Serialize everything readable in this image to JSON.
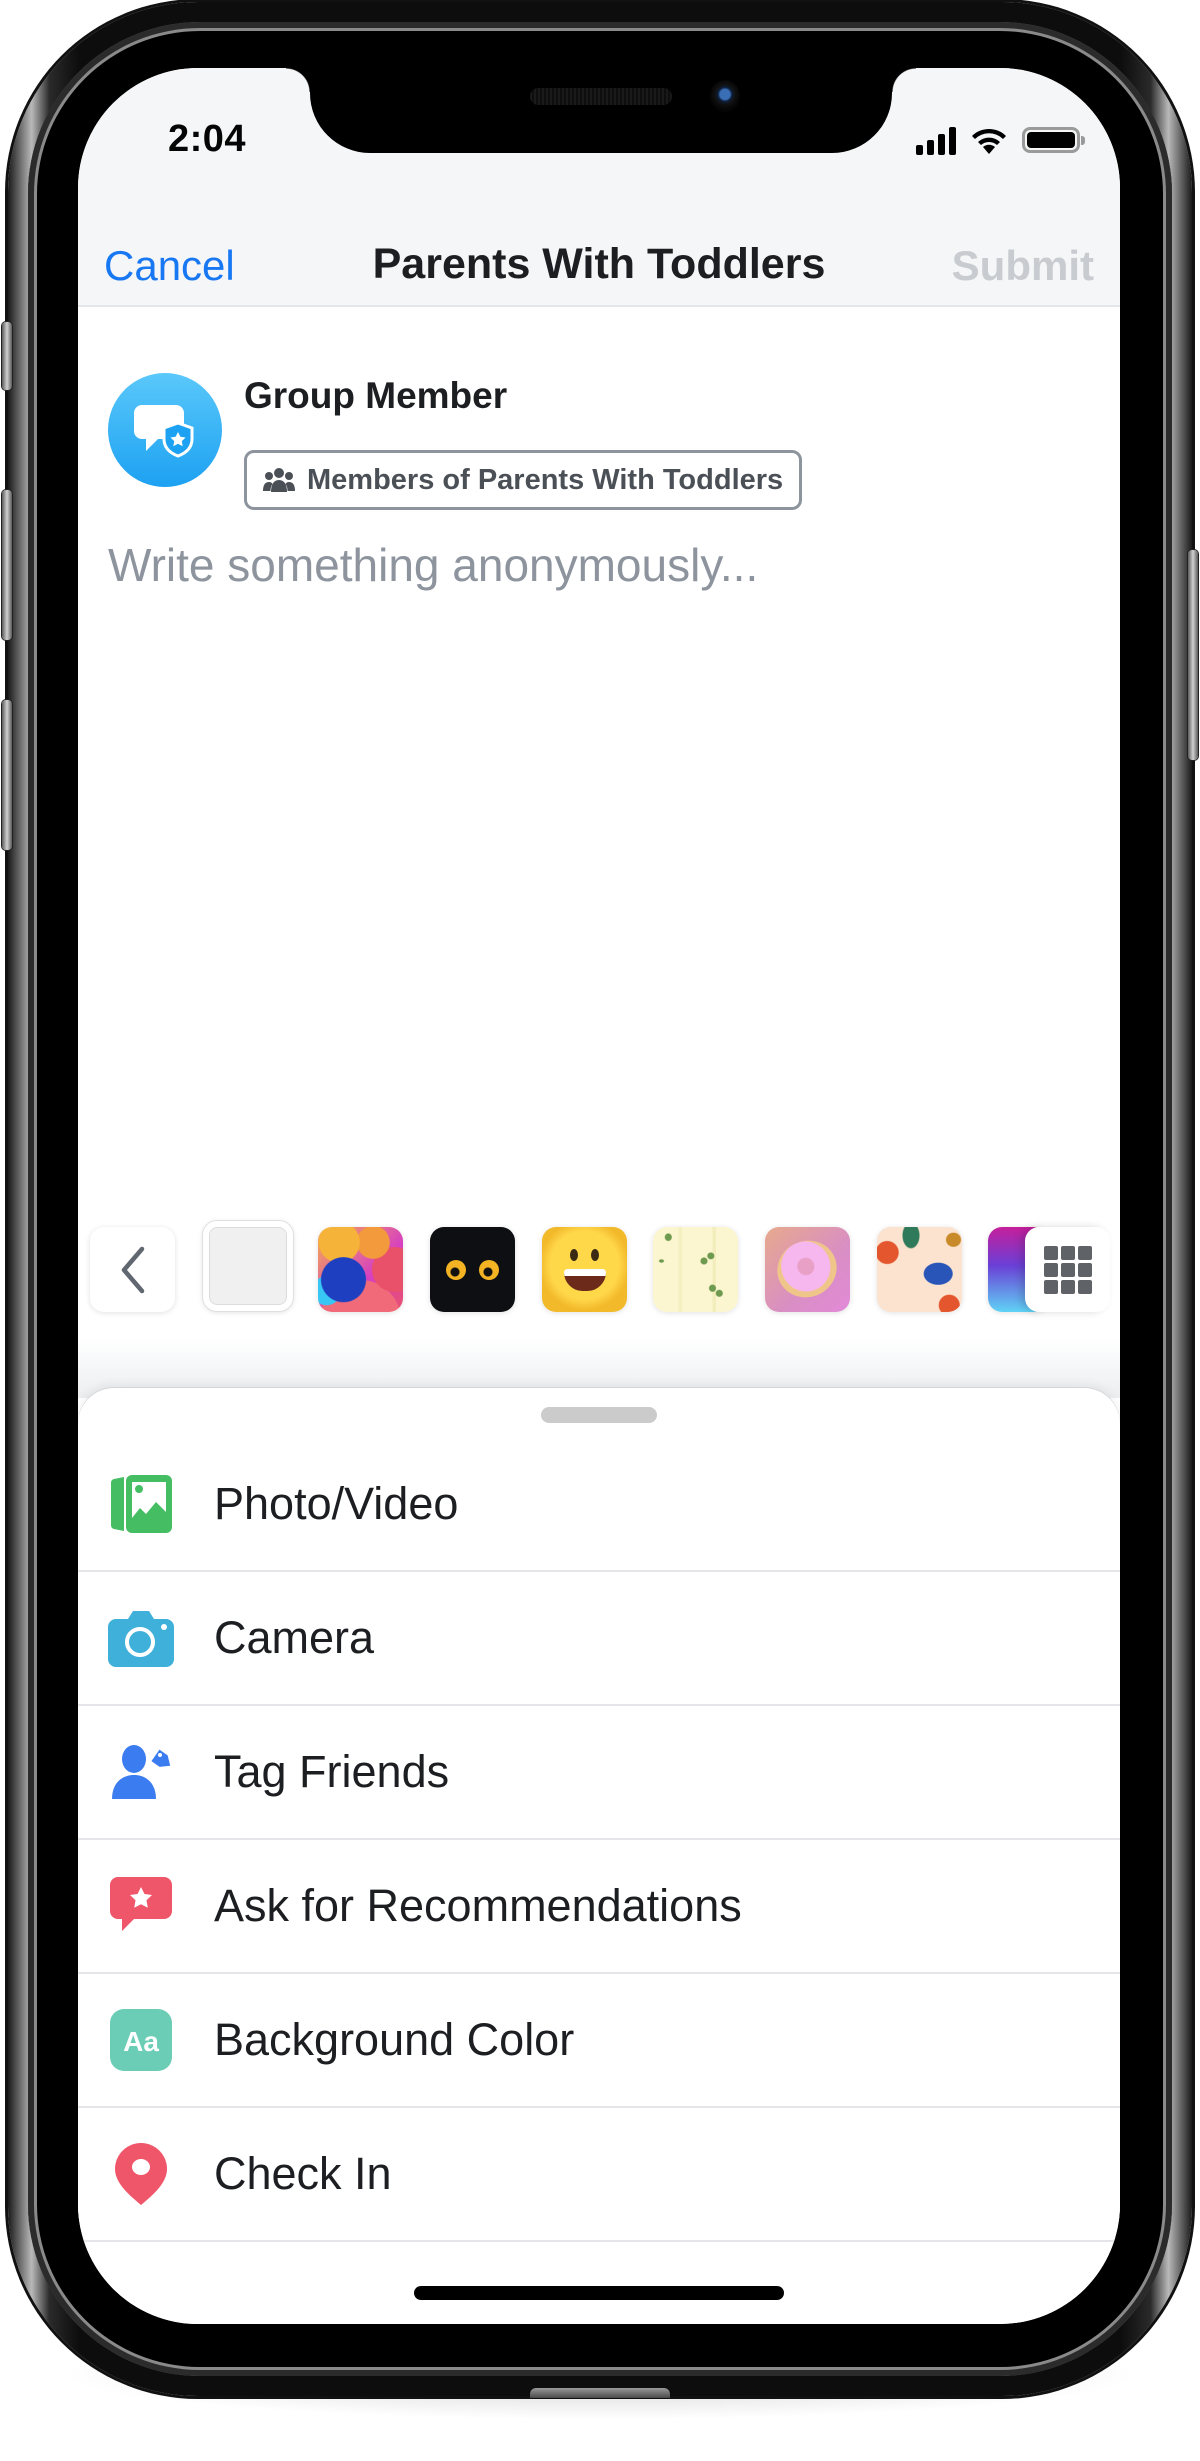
{
  "status_bar": {
    "time": "2:04",
    "icons": [
      "cellular-signal-icon",
      "wifi-icon",
      "battery-icon"
    ]
  },
  "nav": {
    "cancel_label": "Cancel",
    "title": "Parents With Toddlers",
    "submit_label": "Submit"
  },
  "colors": {
    "accent": "#1877f2",
    "disabled": "#c8cbcf",
    "avatar": "#1da1f2",
    "photo_video": "#45bd62",
    "camera": "#3fb0d9",
    "tag_friends": "#3b7cf0",
    "recommendations": "#f0566a",
    "background_color": "#6bcdb6",
    "check_in": "#f0566a"
  },
  "composer": {
    "author_name": "Group Member",
    "avatar_icon": "anonymous-shield-chat-icon",
    "audience_label": "Members of Parents With Toddlers",
    "audience_icon": "group-people-icon",
    "placeholder": "Write something anonymously..."
  },
  "backgrounds": {
    "back_icon": "chevron-left-icon",
    "more_icon": "grid-icon",
    "swatches": [
      {
        "name": "plain-white",
        "selected": true
      },
      {
        "name": "balloons"
      },
      {
        "name": "peeking-eyes"
      },
      {
        "name": "smiley-face"
      },
      {
        "name": "leaves-pattern"
      },
      {
        "name": "donut"
      },
      {
        "name": "floral-bird"
      },
      {
        "name": "purple-blue-gradient"
      }
    ]
  },
  "sheet": {
    "items": [
      {
        "label": "Photo/Video",
        "icon": "photo-video-icon"
      },
      {
        "label": "Camera",
        "icon": "camera-icon"
      },
      {
        "label": "Tag Friends",
        "icon": "tag-friends-icon"
      },
      {
        "label": "Ask for Recommendations",
        "icon": "recommendations-icon"
      },
      {
        "label": "Background Color",
        "icon": "background-color-icon"
      },
      {
        "label": "Check In",
        "icon": "check-in-icon"
      }
    ]
  }
}
